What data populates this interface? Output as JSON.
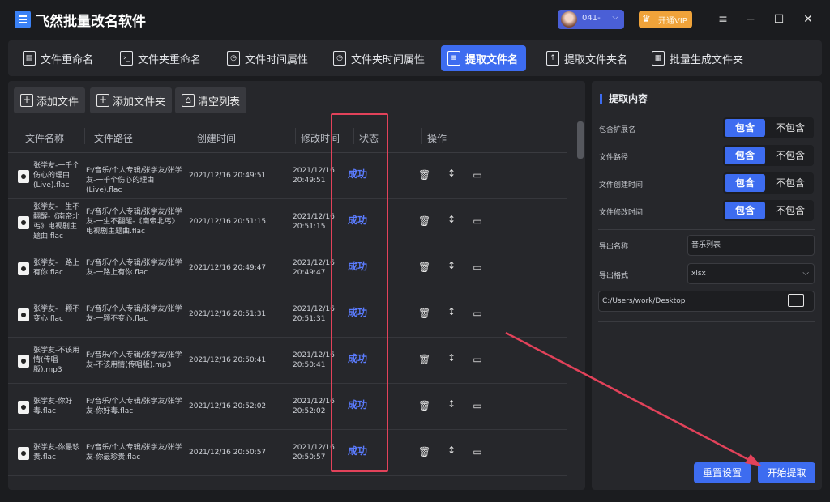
{
  "app": {
    "title": "飞然批量改名软件"
  },
  "header": {
    "user": {
      "name": "041-"
    },
    "vip_label": "开通VIP",
    "minimize": "−",
    "maximize": "☐",
    "close": "✕",
    "menu": "≡"
  },
  "tabs": [
    {
      "label": "文件重命名",
      "icon": "file-rename-icon",
      "active": false
    },
    {
      "label": "文件夹重命名",
      "icon": "folder-rename-icon",
      "active": false
    },
    {
      "label": "文件时间属性",
      "icon": "clock-file-icon",
      "active": false
    },
    {
      "label": "文件夹时间属性",
      "icon": "clock-folder-icon",
      "active": false
    },
    {
      "label": "提取文件名",
      "icon": "extract-file-icon",
      "active": true
    },
    {
      "label": "提取文件夹名",
      "icon": "extract-folder-icon",
      "active": false
    },
    {
      "label": "批量生成文件夹",
      "icon": "batch-folder-icon",
      "active": false
    }
  ],
  "toolbar": {
    "add_file": "添加文件",
    "add_folder": "添加文件夹",
    "clear_list": "清空列表"
  },
  "table": {
    "headers": [
      "文件名称",
      "文件路径",
      "创建时间",
      "修改时间",
      "状态",
      "操作"
    ],
    "rows": [
      {
        "name": "张学友-一千个伤心的理由(Live).flac",
        "path": "F:/音乐/个人专辑/张学友/张学友-一千个伤心的理由(Live).flac",
        "ctime": "2021/12/16 20:49:51",
        "mdate": "2021/12/16",
        "mtime": "20:49:51",
        "status": "成功"
      },
      {
        "name": "张学友-一生不翻醒-《南帝北丐》电视剧主题曲.flac",
        "path": "F:/音乐/个人专辑/张学友/张学友-一生不翻醒-《南帝北丐》电视剧主题曲.flac",
        "ctime": "2021/12/16 20:51:15",
        "mdate": "2021/12/16",
        "mtime": "20:51:15",
        "status": "成功"
      },
      {
        "name": "张学友-一路上有你.flac",
        "path": "F:/音乐/个人专辑/张学友/张学友-一路上有你.flac",
        "ctime": "2021/12/16 20:49:47",
        "mdate": "2021/12/16",
        "mtime": "20:49:47",
        "status": "成功"
      },
      {
        "name": "张学友-一颗不变心.flac",
        "path": "F:/音乐/个人专辑/张学友/张学友-一颗不变心.flac",
        "ctime": "2021/12/16 20:51:31",
        "mdate": "2021/12/16",
        "mtime": "20:51:31",
        "status": "成功"
      },
      {
        "name": "张学友-不该用情(传唱版).mp3",
        "path": "F:/音乐/个人专辑/张学友/张学友-不该用情(传唱版).mp3",
        "ctime": "2021/12/16 20:50:41",
        "mdate": "2021/12/16",
        "mtime": "20:50:41",
        "status": "成功"
      },
      {
        "name": "张学友-你好毒.flac",
        "path": "F:/音乐/个人专辑/张学友/张学友-你好毒.flac",
        "ctime": "2021/12/16 20:52:02",
        "mdate": "2021/12/16",
        "mtime": "20:52:02",
        "status": "成功"
      },
      {
        "name": "张学友-你最珍贵.flac",
        "path": "F:/音乐/个人专辑/张学友/张学友-你最珍贵.flac",
        "ctime": "2021/12/16 20:50:57",
        "mdate": "2021/12/16",
        "mtime": "20:50:57",
        "status": "成功"
      }
    ]
  },
  "panel": {
    "title": "提取内容",
    "options": [
      {
        "label": "包含扩展名",
        "on": "包含",
        "off": "不包含"
      },
      {
        "label": "文件路径",
        "on": "包含",
        "off": "不包含"
      },
      {
        "label": "文件创建时间",
        "on": "包含",
        "off": "不包含"
      },
      {
        "label": "文件修改时间",
        "on": "包含",
        "off": "不包含"
      }
    ],
    "export_name_label": "导出名称",
    "export_name_value": "音乐列表",
    "export_format_label": "导出格式",
    "export_format_value": "xlsx",
    "export_path": "C:/Users/work/Desktop",
    "reset_button": "重置设置",
    "start_button": "开始提取"
  },
  "colors": {
    "accent": "#3d6cf0",
    "success": "#5b7cff",
    "highlight": "#e2425a"
  }
}
